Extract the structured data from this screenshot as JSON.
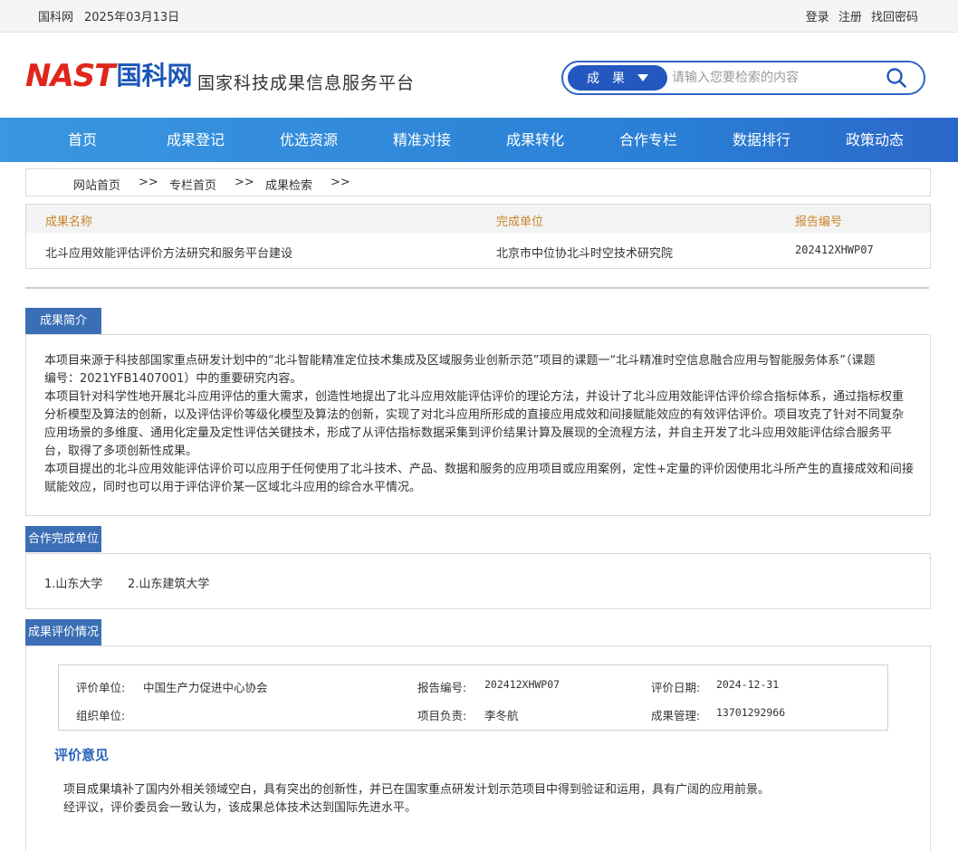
{
  "topbar": {
    "site": "国科网",
    "date": "2025年03月13日",
    "login": "登录",
    "register": "注册",
    "recover": "找回密码"
  },
  "header": {
    "logo_en": "NAST",
    "logo_cn": "国科网",
    "platform": "国家科技成果信息服务平台",
    "search_category": "成　果",
    "search_placeholder": "请输入您要检索的内容"
  },
  "nav": [
    "首页",
    "成果登记",
    "优选资源",
    "精准对接",
    "成果转化",
    "合作专栏",
    "数据排行",
    "政策动态"
  ],
  "breadcrumb": {
    "home": "网站首页",
    "sep1": ">>",
    "column": "专栏首页",
    "sep2": ">>",
    "search": "成果检索",
    "sep3": ">>"
  },
  "result_table": {
    "headers": [
      "成果名称",
      "完成单位",
      "报告编号"
    ],
    "row": [
      "北斗应用效能评估评价方法研究和服务平台建设",
      "北京市中位协北斗时空技术研究院",
      "202412XHWP07"
    ]
  },
  "intro": {
    "tab": "成果简介",
    "lines": [
      "本项目来源于科技部国家重点研发计划中的“北斗智能精准定位技术集成及区域服务业创新示范”项目的课题一“北斗精准时空信息融合应用与智能服务体系”（课题",
      "编号：2021YFB1407001）中的重要研究内容。",
      "本项目针对科学性地开展北斗应用评估的重大需求，创造性地提出了北斗应用效能评估评价的理论方法，并设计了北斗应用效能评估评价综合指标体系，通过指标权重",
      "分析模型及算法的创新，以及评估评价等级化模型及算法的创新，实现了对北斗应用所形成的直接应用成效和间接赋能效应的有效评估评价。项目攻克了针对不同复杂",
      "应用场景的多维度、通用化定量及定性评估关键技术，形成了从评估指标数据采集到评价结果计算及展现的全流程方法，并自主开发了北斗应用效能评估综合服务平",
      "台，取得了多项创新性成果。",
      "本项目提出的北斗应用效能评估评价可以应用于任何使用了北斗技术、产品、数据和服务的应用项目或应用案例，定性+定量的评价因使用北斗所产生的直接成效和间接",
      "赋能效应，同时也可以用于评估评价某一区域北斗应用的综合水平情况。"
    ]
  },
  "coop": {
    "tab": "合作完成单位",
    "units": [
      "1.山东大学",
      "2.山东建筑大学"
    ]
  },
  "evaluation": {
    "tab": "成果评价情况",
    "eval_unit_label": "评价单位:",
    "eval_unit": "中国生产力促进中心协会",
    "report_no_label": "报告编号:",
    "report_no": "202412XHWP07",
    "eval_date_label": "评价日期:",
    "eval_date": "2024-12-31",
    "org_unit_label": "组织单位:",
    "org_unit": "",
    "leader_label": "项目负责:",
    "leader": "李冬航",
    "manager_label": "成果管理:",
    "manager": "13701292966",
    "opinion_title": "评价意见",
    "opinion_lines": [
      "项目成果填补了国内外相关领域空白，具有突出的创新性，并已在国家重点研发计划示范项目中得到验证和运用，具有广阔的应用前景。",
      "经评议，评价委员会一致认为，该成果总体技术达到国际先进水平。"
    ]
  },
  "colors": {
    "brand_blue": "#2457bf",
    "nav_blue": "#2a7fd6",
    "section_tab": "#3b6fb5",
    "table_header_text": "#c8862a",
    "logo_red": "#e0261b"
  }
}
